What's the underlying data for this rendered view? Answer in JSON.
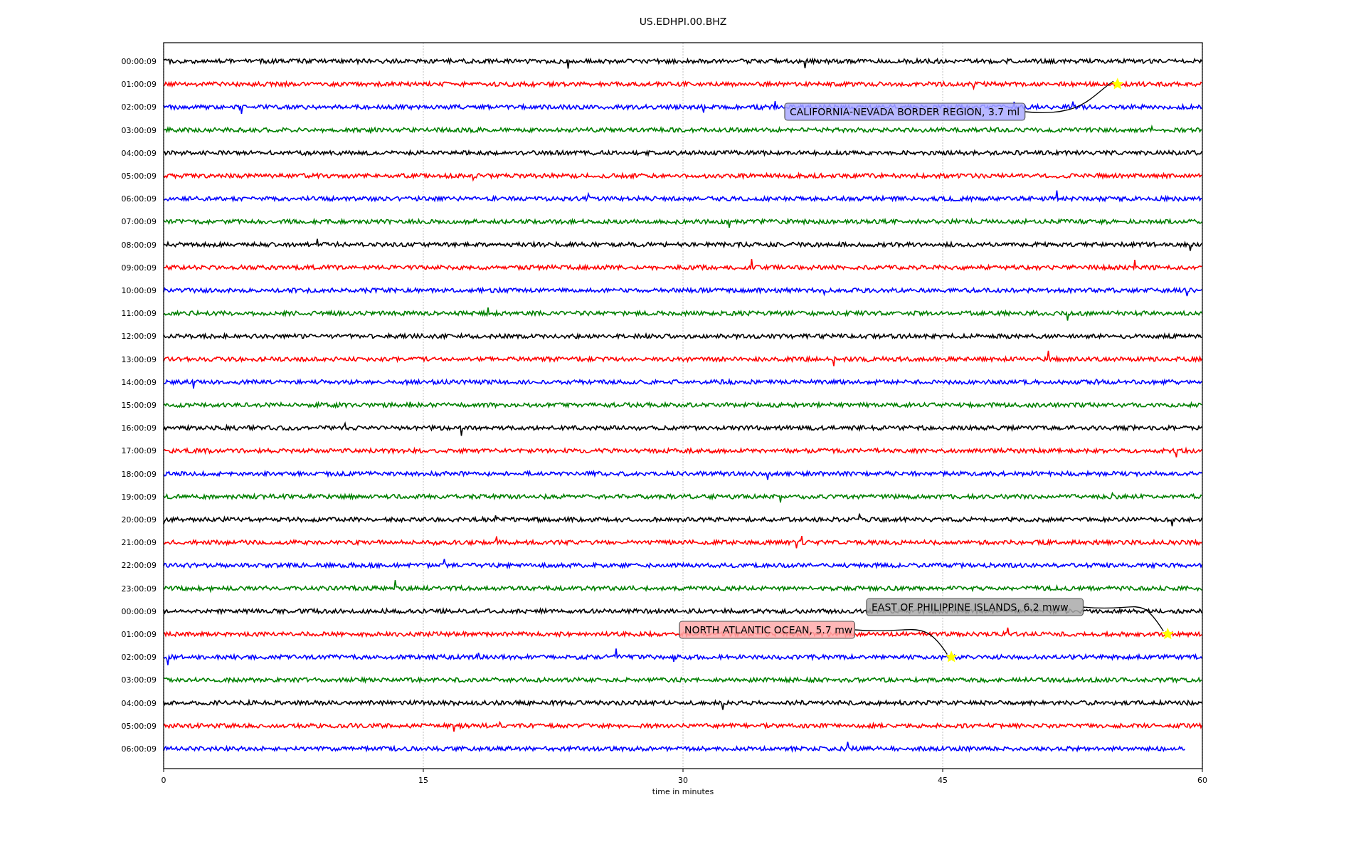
{
  "title": "US.EDHPI.00.BHZ",
  "rows": [
    {
      "label": "00:00:09",
      "color": "#000000"
    },
    {
      "label": "01:00:09",
      "color": "#ff0000"
    },
    {
      "label": "02:00:09",
      "color": "#0000ff"
    },
    {
      "label": "03:00:09",
      "color": "#008000"
    },
    {
      "label": "04:00:09",
      "color": "#000000"
    },
    {
      "label": "05:00:09",
      "color": "#ff0000"
    },
    {
      "label": "06:00:09",
      "color": "#0000ff"
    },
    {
      "label": "07:00:09",
      "color": "#008000"
    },
    {
      "label": "08:00:09",
      "color": "#000000"
    },
    {
      "label": "09:00:09",
      "color": "#ff0000"
    },
    {
      "label": "10:00:09",
      "color": "#0000ff"
    },
    {
      "label": "11:00:09",
      "color": "#008000"
    },
    {
      "label": "12:00:09",
      "color": "#000000"
    },
    {
      "label": "13:00:09",
      "color": "#ff0000"
    },
    {
      "label": "14:00:09",
      "color": "#0000ff"
    },
    {
      "label": "15:00:09",
      "color": "#008000"
    },
    {
      "label": "16:00:09",
      "color": "#000000"
    },
    {
      "label": "17:00:09",
      "color": "#ff0000"
    },
    {
      "label": "18:00:09",
      "color": "#0000ff"
    },
    {
      "label": "19:00:09",
      "color": "#008000"
    },
    {
      "label": "20:00:09",
      "color": "#000000"
    },
    {
      "label": "21:00:09",
      "color": "#ff0000"
    },
    {
      "label": "22:00:09",
      "color": "#0000ff"
    },
    {
      "label": "23:00:09",
      "color": "#008000"
    },
    {
      "label": "00:00:09",
      "color": "#000000"
    },
    {
      "label": "01:00:09",
      "color": "#ff0000"
    },
    {
      "label": "02:00:09",
      "color": "#0000ff"
    },
    {
      "label": "03:00:09",
      "color": "#008000"
    },
    {
      "label": "04:00:09",
      "color": "#000000"
    },
    {
      "label": "05:00:09",
      "color": "#ff0000"
    },
    {
      "label": "06:00:09",
      "color": "#0000ff"
    }
  ],
  "events": [
    {
      "label": "CALIFORNIA-NEVADA BORDER REGION, 3.7 ml",
      "color": "#aaaaff"
    },
    {
      "label": "EAST OF PHILIPPINE ISLANDS, 6.2 mww",
      "color": "#aaaaaa"
    },
    {
      "label": "NORTH ATLANTIC OCEAN, 5.7 mw",
      "color": "#ffaaaa"
    }
  ],
  "xticks": [
    "0",
    "15",
    "30",
    "45",
    "60"
  ],
  "xlabel": "time in minutes"
}
